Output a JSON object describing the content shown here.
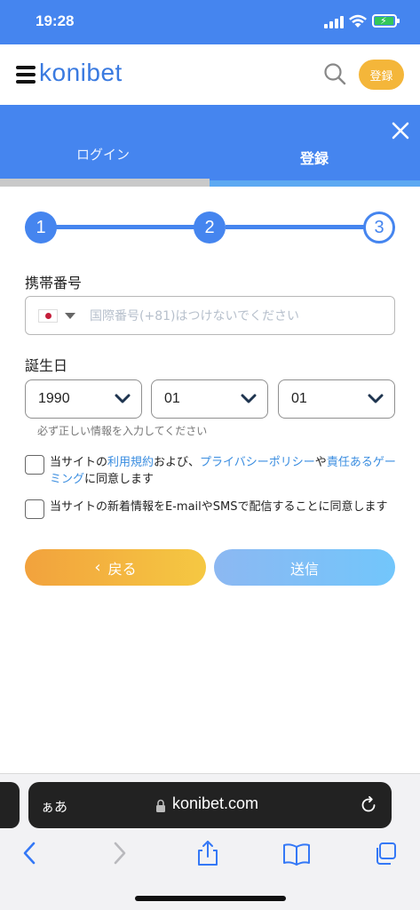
{
  "status_bar": {
    "time": "19:28"
  },
  "header": {
    "logo": "konibet",
    "register_label": "登録"
  },
  "tabs": [
    {
      "label": "ログイン",
      "active": false
    },
    {
      "label": "登録",
      "active": true
    }
  ],
  "stepper": {
    "steps": [
      "1",
      "2",
      "3"
    ],
    "current": 3
  },
  "form": {
    "phone_label": "携帯番号",
    "phone_placeholder": "国際番号(+81)はつけないでください",
    "phone_value": "",
    "birthday_label": "誕生日",
    "year": "1990",
    "month": "01",
    "day": "01",
    "hint": "必ず正しい情報を入力してください"
  },
  "consents": {
    "terms": {
      "prefix": "当サイトの",
      "terms_link": "利用規約",
      "mid1": "および、",
      "privacy_link": "プライバシーポリシー",
      "mid2": "や",
      "responsible_link": "責任あるゲーミング",
      "suffix": "に同意します",
      "checked": false
    },
    "newsletter": {
      "text": "当サイトの新着情報をE-mailやSMSで配信することに同意します",
      "checked": false
    }
  },
  "buttons": {
    "back": "戻る",
    "send": "送信"
  },
  "safari": {
    "aa": "ぁあ",
    "url": "konibet.com"
  },
  "colors": {
    "primary": "#4585ef",
    "accent": "#f4b63a",
    "link": "#3a8de0"
  }
}
